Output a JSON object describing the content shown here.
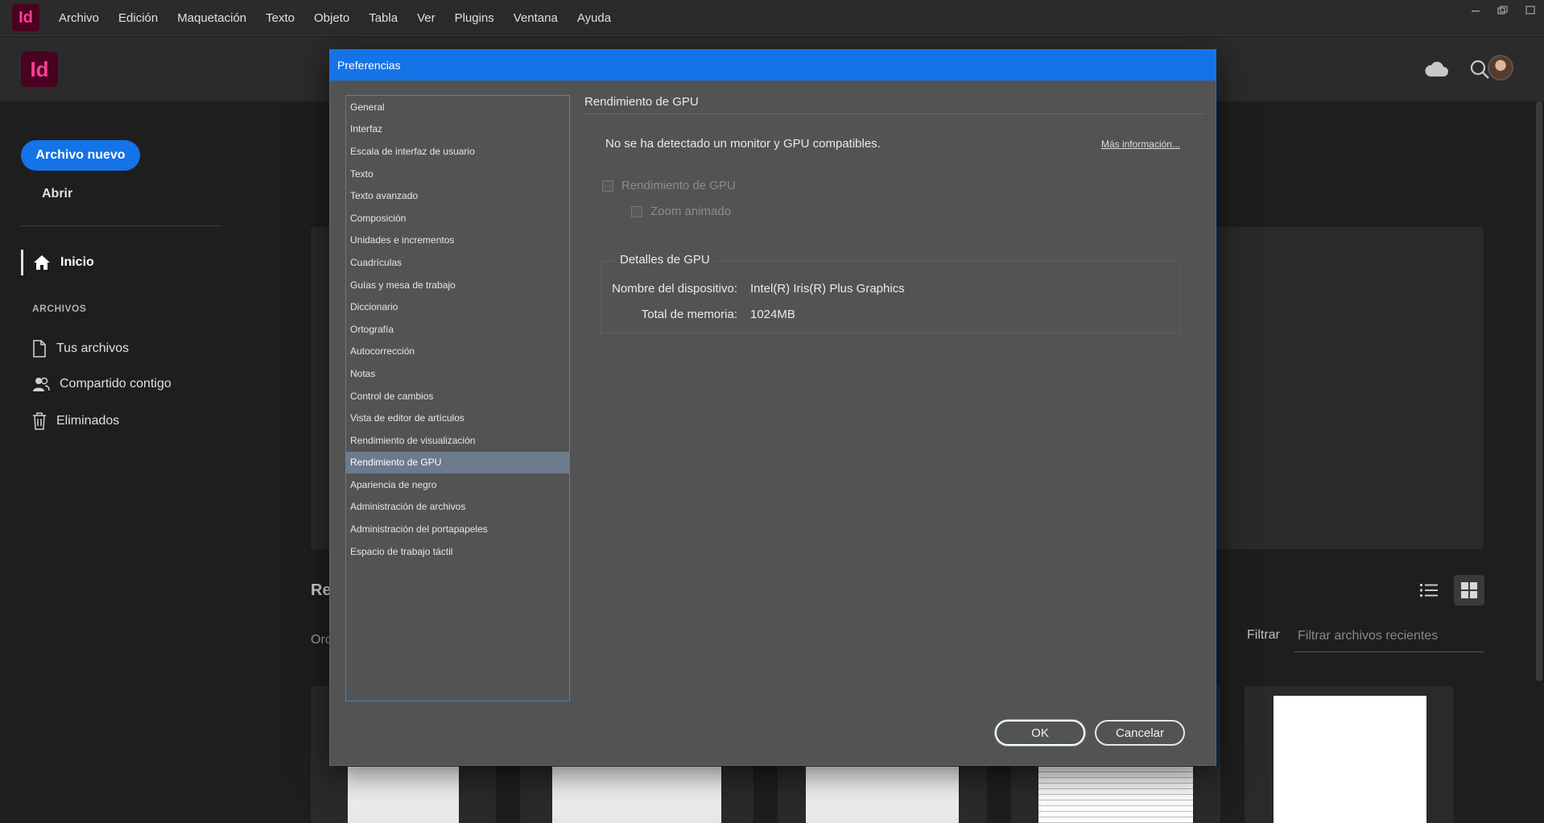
{
  "menubar": {
    "logo": "Id",
    "items": [
      "Archivo",
      "Edición",
      "Maquetación",
      "Texto",
      "Objeto",
      "Tabla",
      "Ver",
      "Plugins",
      "Ventana",
      "Ayuda"
    ]
  },
  "header": {
    "logo": "Id",
    "icons": [
      "cloud-icon",
      "search-icon",
      "avatar"
    ]
  },
  "sidebar": {
    "new_button": "Archivo nuevo",
    "open_link": "Abrir",
    "home": "Inicio",
    "section_title": "ARCHIVOS",
    "items": [
      "Tus archivos",
      "Compartido contigo",
      "Eliminados"
    ]
  },
  "background": {
    "recent_title": "Re",
    "sort_label": "Orc",
    "filter_label": "Filtrar",
    "filter_placeholder": "Filtrar archivos recientes"
  },
  "dialog": {
    "title": "Preferencias",
    "categories": [
      "General",
      "Interfaz",
      "Escala de interfaz de usuario",
      "Texto",
      "Texto avanzado",
      "Composición",
      "Unidades e incrementos",
      "Cuadrículas",
      "Guías y mesa de trabajo",
      "Diccionario",
      "Ortografía",
      "Autocorrección",
      "Notas",
      "Control de cambios",
      "Vista de editor de artículos",
      "Rendimiento de visualización",
      "Rendimiento de GPU",
      "Apariencia de negro",
      "Administración de archivos",
      "Administración del portapapeles",
      "Espacio de trabajo táctil"
    ],
    "selected_category": "Rendimiento de GPU",
    "panel": {
      "title": "Rendimiento de GPU",
      "notice": "No se ha detectado un monitor y GPU compatibles.",
      "more_info": "Más información...",
      "checkbox_gpu": "Rendimiento de GPU",
      "checkbox_zoom": "Zoom animado",
      "group_title": "Detalles de GPU",
      "device_label": "Nombre del dispositivo:",
      "device_value": "Intel(R) Iris(R) Plus Graphics",
      "memory_label": "Total de memoria:",
      "memory_value": "1024MB"
    },
    "ok": "OK",
    "cancel": "Cancelar"
  },
  "colors": {
    "accent": "#1473e6",
    "dialog_bg": "#535353",
    "selected_row": "#6c7b8c",
    "indesign_pink": "#ff3f94"
  }
}
